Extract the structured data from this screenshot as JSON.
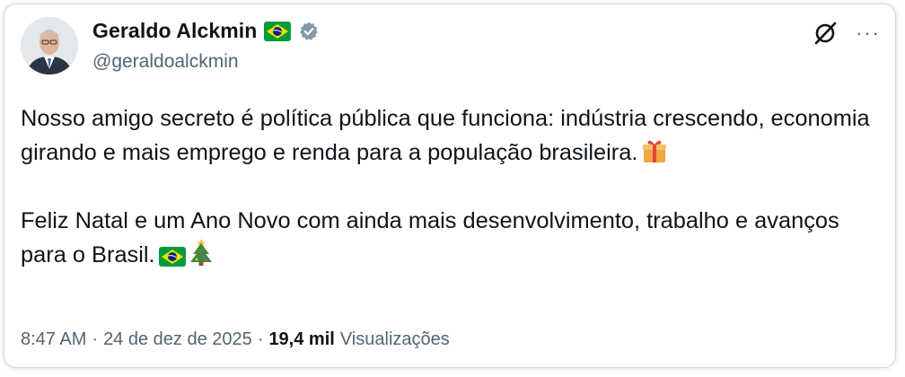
{
  "author": {
    "display_name": "Geraldo Alckmin",
    "handle": "@geraldoalckmin",
    "flag_icon": "brazil-flag-emoji",
    "verified_icon": "verified-badge-icon"
  },
  "header_icons": {
    "grok_icon": "grok-icon",
    "more_label": "···"
  },
  "tweet": {
    "paragraph_1": "Nosso amigo secreto é política pública que funciona: indústria crescendo, economia girando e mais emprego e renda para a população brasileira.",
    "paragraph_1_emoji": "gift-emoji",
    "paragraph_2": "Feliz Natal e um Ano Novo com ainda mais desenvolvimento, trabalho e avanços para o Brasil.",
    "paragraph_2_emojis": [
      "brazil-flag-emoji",
      "christmas-tree-emoji"
    ]
  },
  "meta": {
    "time": "8:47 AM",
    "separator": "·",
    "date": "24 de dez de 2025",
    "views_count": "19,4 mil",
    "views_label": "Visualizações"
  },
  "colors": {
    "text": "#0f1419",
    "secondary": "#536471",
    "border": "#cfd9de",
    "verified": "#829aab"
  }
}
